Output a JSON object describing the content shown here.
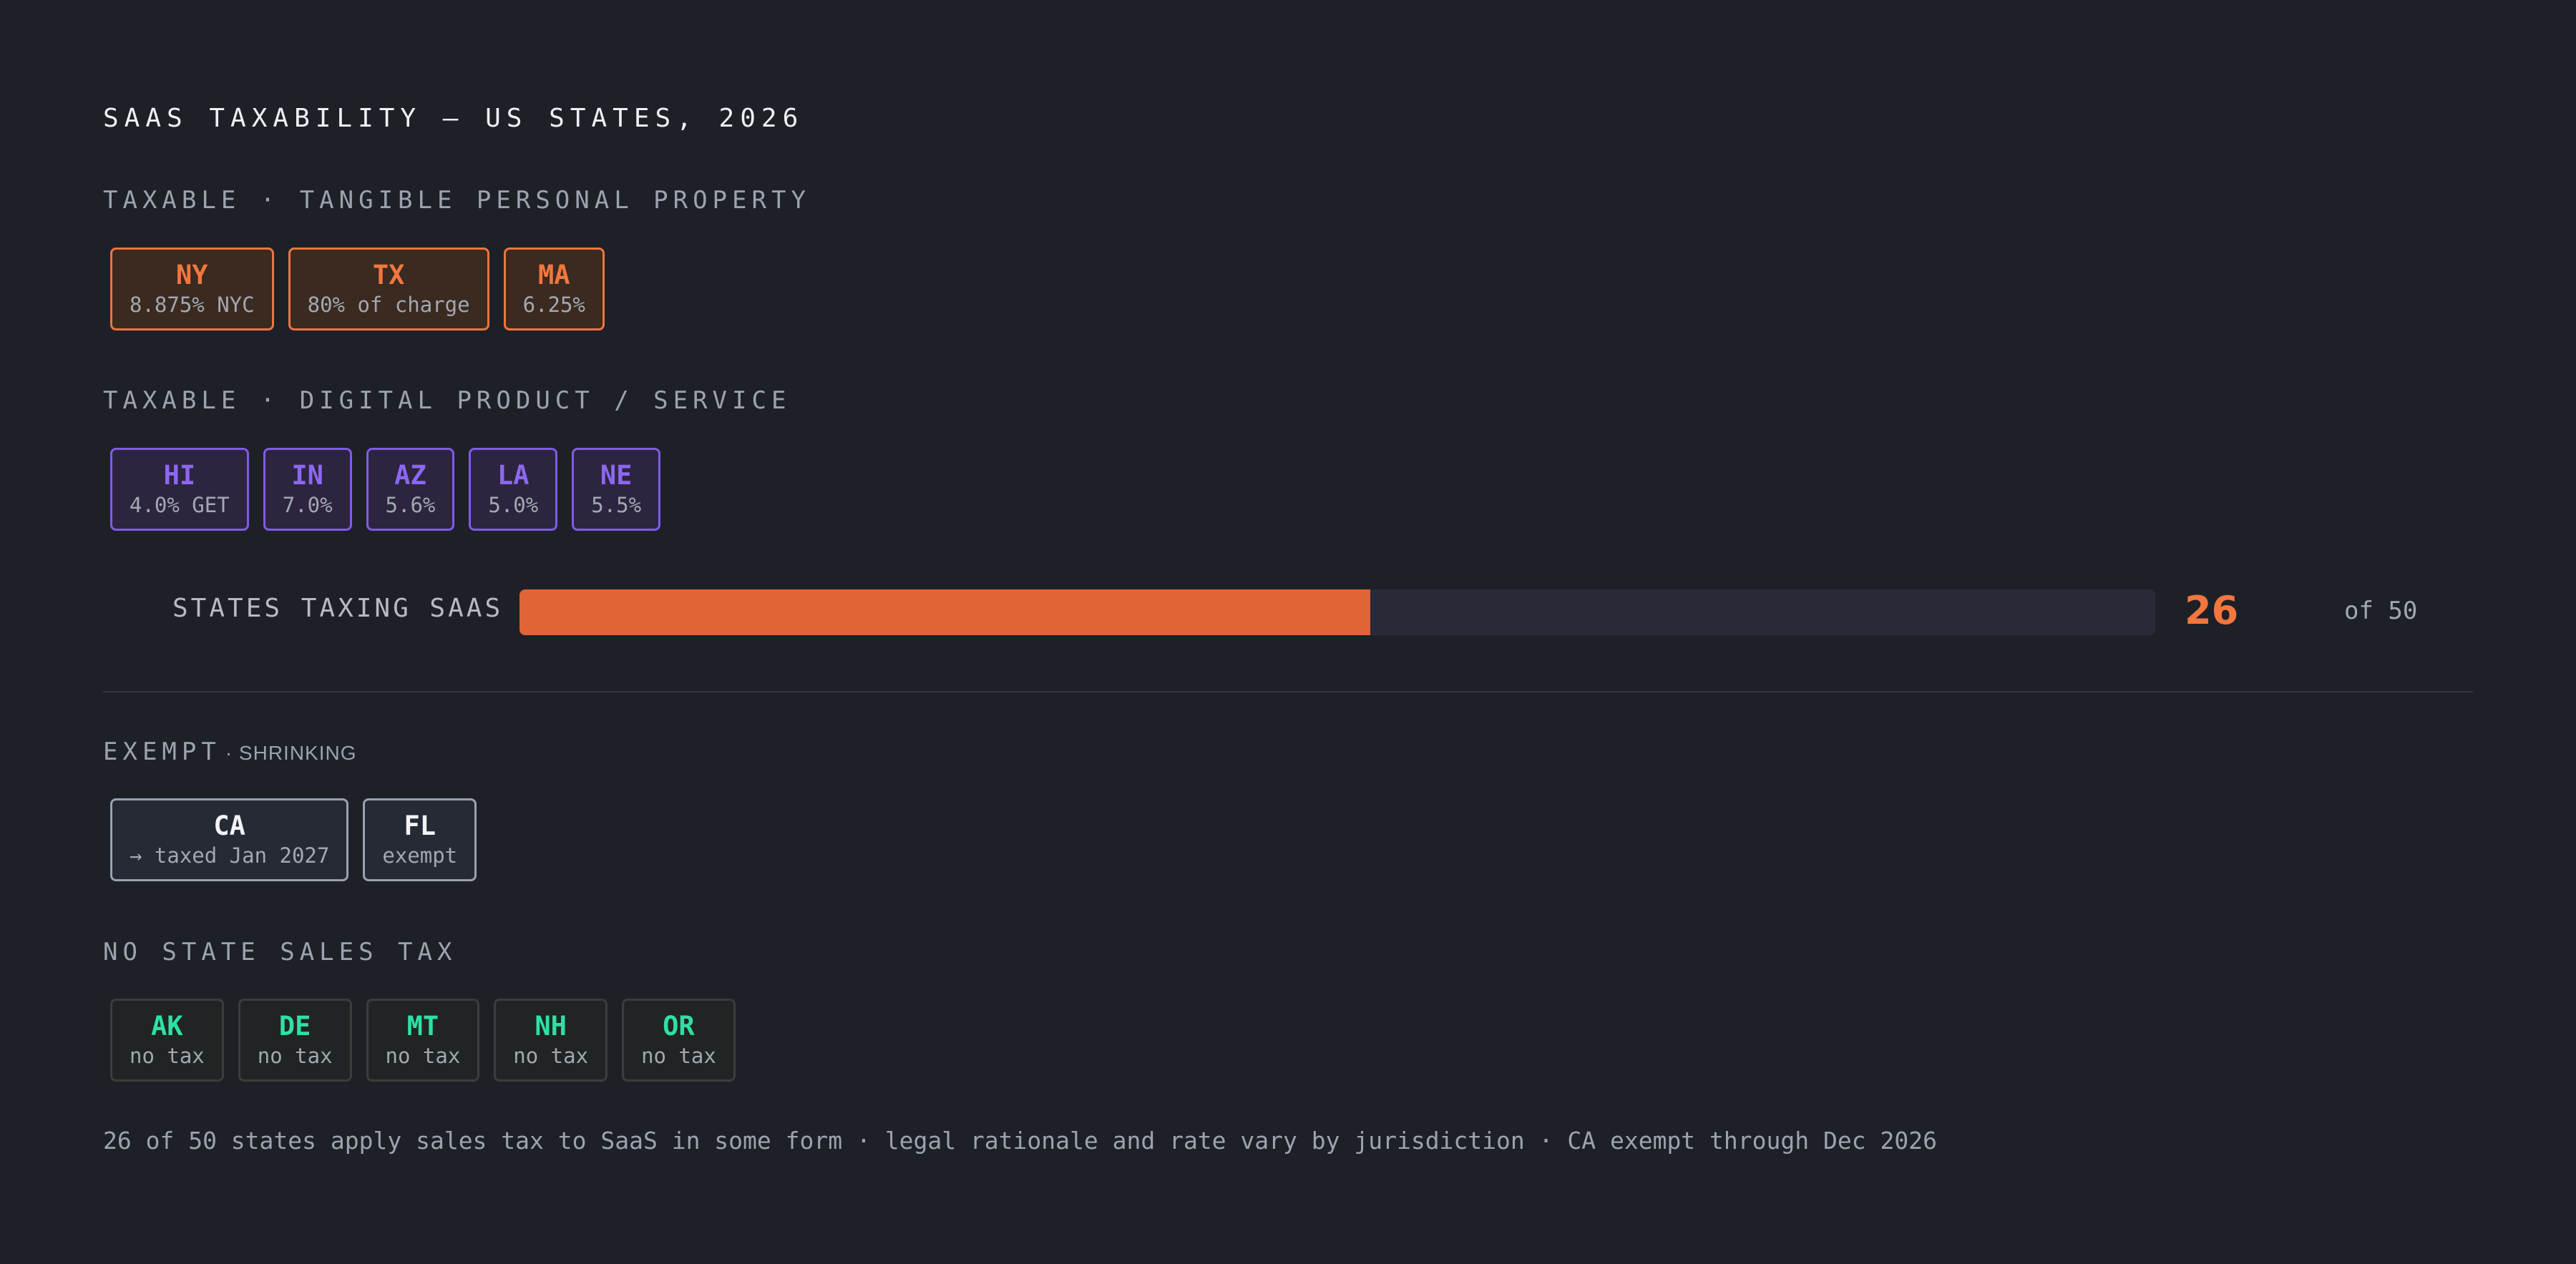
{
  "title": "SAAS TAXABILITY — US STATES, 2026",
  "colors": {
    "background": "#1e2028",
    "tangible_personal_property": "#f2773f",
    "digital_product_service": "#8d67f2",
    "exempt": "#f2f3f6",
    "no_state_sales_tax": "#2fe0a2",
    "bar_fill": "#e06436",
    "bar_track": "#282a38"
  },
  "sections": {
    "tpp": {
      "label": "TAXABLE · TANGIBLE PERSONAL PROPERTY",
      "states": [
        {
          "code": "NY",
          "note": "8.875% NYC"
        },
        {
          "code": "TX",
          "note": "80% of charge"
        },
        {
          "code": "MA",
          "note": "6.25%"
        }
      ]
    },
    "digital": {
      "label": "TAXABLE · DIGITAL PRODUCT / SERVICE",
      "states": [
        {
          "code": "HI",
          "note": "4.0% GET"
        },
        {
          "code": "IN",
          "note": "7.0%"
        },
        {
          "code": "AZ",
          "note": "5.6%"
        },
        {
          "code": "LA",
          "note": "5.0%"
        },
        {
          "code": "NE",
          "note": "5.5%"
        }
      ]
    },
    "exempt": {
      "label": "EXEMPT",
      "sublabel": "· SHRINKING",
      "states": [
        {
          "code": "CA",
          "note": "→ taxed Jan 2027"
        },
        {
          "code": "FL",
          "note": "exempt"
        }
      ]
    },
    "notax": {
      "label": "NO STATE SALES TAX",
      "states": [
        {
          "code": "AK",
          "note": "no tax"
        },
        {
          "code": "DE",
          "note": "no tax"
        },
        {
          "code": "MT",
          "note": "no tax"
        },
        {
          "code": "NH",
          "note": "no tax"
        },
        {
          "code": "OR",
          "note": "no tax"
        }
      ]
    }
  },
  "chart_data": {
    "type": "bar",
    "categories": [
      "STATES TAXING SAAS"
    ],
    "values": [
      26
    ],
    "ylim": [
      0,
      50
    ],
    "value_label": "26",
    "total_label": "of 50"
  },
  "footnote": "26 of 50 states apply sales tax to SaaS in some form · legal rationale and rate vary by jurisdiction · CA exempt through Dec 2026"
}
